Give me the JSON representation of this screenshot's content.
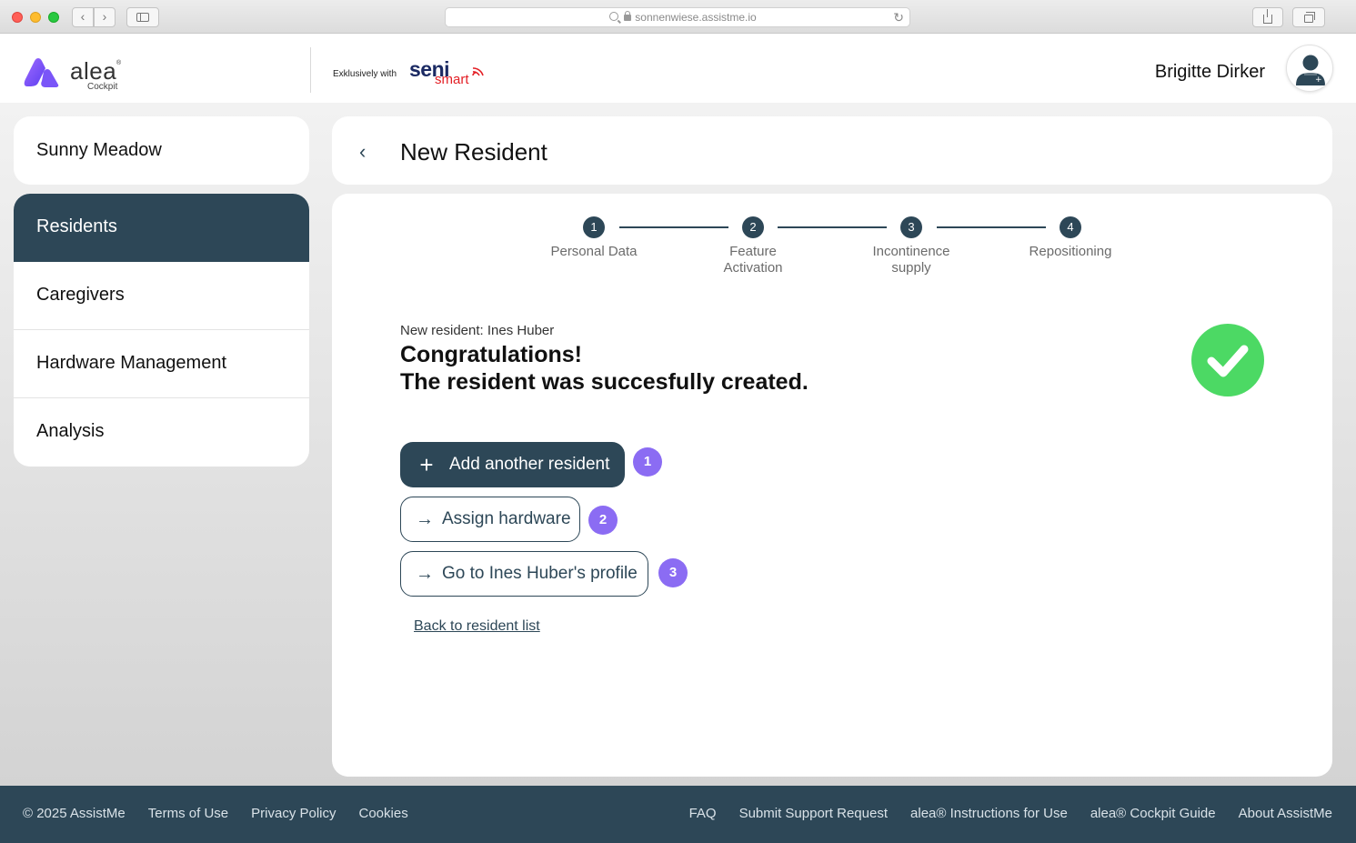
{
  "browser": {
    "url": "sonnenwiese.assistme.io",
    "back_glyph": "‹",
    "forward_glyph": "›",
    "reload_glyph": "↻"
  },
  "header": {
    "logo_word": "alea",
    "logo_reg": "®",
    "logo_sub": "Cockpit",
    "exclusive_label": "Exklusively with",
    "brand_top": "seni",
    "brand_bottom": "smart",
    "user_name": "Brigitte Dirker"
  },
  "sidebar": {
    "facility": "Sunny Meadow",
    "items": [
      {
        "label": "Residents",
        "active": true
      },
      {
        "label": "Caregivers",
        "active": false
      },
      {
        "label": "Hardware Management",
        "active": false
      },
      {
        "label": "Analysis",
        "active": false
      }
    ]
  },
  "page": {
    "back_glyph": "‹",
    "title": "New Resident"
  },
  "stepper": [
    {
      "num": "1",
      "label": "Personal Data"
    },
    {
      "num": "2",
      "label": "Feature\nActivation"
    },
    {
      "num": "3",
      "label": "Incontinence\nsupply"
    },
    {
      "num": "4",
      "label": "Repositioning"
    }
  ],
  "result": {
    "sub_label": "New resident: Ines Huber",
    "line1": "Congratulations!",
    "line2": "The resident was succesfully created."
  },
  "actions": {
    "add_icon": "+",
    "add_label": "Add another resident",
    "add_badge": "1",
    "arrow_icon": "→",
    "assign_label": "Assign hardware",
    "assign_badge": "2",
    "profile_label": "Go to Ines Huber's profile",
    "profile_badge": "3",
    "back_link": "Back to resident list"
  },
  "footer": {
    "left": [
      "© 2025 AssistMe",
      "Terms of Use",
      "Privacy Policy",
      "Cookies"
    ],
    "right": [
      "FAQ",
      "Submit Support Request",
      "alea® Instructions for Use",
      "alea® Cockpit Guide",
      "About AssistMe"
    ]
  },
  "colors": {
    "primary": "#2d4757",
    "success": "#4cd964",
    "badge": "#8b6cf3"
  }
}
